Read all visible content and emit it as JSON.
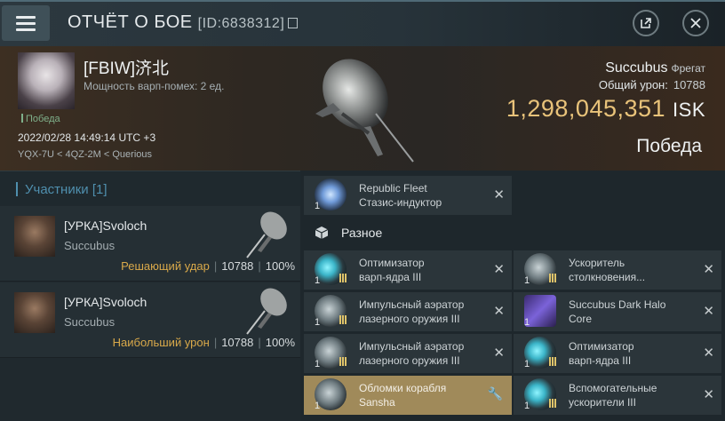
{
  "topbar": {
    "title": "ОТЧЁТ О БОЕ",
    "report_id": "[ID:6838312]"
  },
  "header": {
    "pilot_name": "[FBIW]济北",
    "warp_scram": "Мощность варп-помех: 2 ед.",
    "status_small": "Победа",
    "datetime": "2022/02/28 14:49:14 UTC +3",
    "location": "YQX-7U < 4QZ-2M < Querious",
    "ship_name": "Succubus",
    "ship_class": "Фрегат",
    "damage_label": "Общий урон:",
    "damage_value": "10788",
    "isk_value": "1,298,045,351",
    "isk_currency": "ISK",
    "result": "Победа"
  },
  "participants": {
    "title": "Участники [1]",
    "rows": [
      {
        "name": "[УРКА]Svoloch",
        "ship": "Succubus",
        "label": "Решающий удар",
        "damage": "10788",
        "percent": "100%"
      },
      {
        "name": "[УРКА]Svoloch",
        "ship": "Succubus",
        "label": "Наибольший урон",
        "damage": "10788",
        "percent": "100%"
      }
    ]
  },
  "items": {
    "top_item": {
      "qty": "1",
      "line1": "Republic Fleet",
      "line2": "Стазис-индуктор"
    },
    "section_label": "Разное",
    "left": [
      {
        "qty": "1",
        "line1": "Оптимизатор",
        "line2": "варп-ядра III"
      },
      {
        "qty": "1",
        "line1": "Импульсный аэратор",
        "line2": "лазерного оружия III"
      },
      {
        "qty": "1",
        "line1": "Импульсный аэратор",
        "line2": "лазерного оружия III"
      },
      {
        "qty": "1",
        "line1": "Обломки корабля",
        "line2": "Sansha"
      }
    ],
    "right": [
      {
        "qty": "1",
        "line1": "Ускоритель",
        "line2": "столкновения..."
      },
      {
        "qty": "1",
        "line1": "Succubus Dark Halo",
        "line2": "Core"
      },
      {
        "qty": "1",
        "line1": "Оптимизатор",
        "line2": "варп-ядра III"
      },
      {
        "qty": "1",
        "line1": "Вспомогательные",
        "line2": "ускорители III"
      }
    ]
  }
}
